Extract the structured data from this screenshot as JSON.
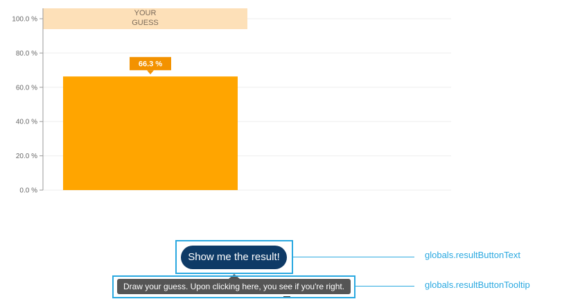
{
  "chart_data": {
    "type": "bar",
    "categories": [
      "YOUR GUESS"
    ],
    "series": [
      {
        "values": [
          66.3
        ]
      }
    ],
    "header_lines": [
      "YOUR",
      "GUESS"
    ],
    "data_label": "66.3 %",
    "yticks": [
      {
        "value": 100,
        "label": "100.0 %"
      },
      {
        "value": 80,
        "label": "80.0 %"
      },
      {
        "value": 60,
        "label": "60.0 %"
      },
      {
        "value": 40,
        "label": "40.0 %"
      },
      {
        "value": 20,
        "label": "20.0 %"
      },
      {
        "value": 0,
        "label": "0.0 %"
      }
    ],
    "ylim": [
      0,
      100
    ],
    "grid": true,
    "colors": {
      "bar": "#ffa500",
      "header_band": "#fde0b8",
      "data_label_bg": "#f39200",
      "grid": "#eeeeee",
      "axis": "#999999"
    }
  },
  "result_button": {
    "label": "Show me the result!",
    "background": "#0e3a66"
  },
  "tooltip": {
    "text": "Draw your guess. Upon clicking here, you see if you're right."
  },
  "annotations": {
    "button_text": "globals.resultButtonText",
    "button_tooltip": "globals.resultButtonTooltip",
    "color": "#29a8e0"
  }
}
